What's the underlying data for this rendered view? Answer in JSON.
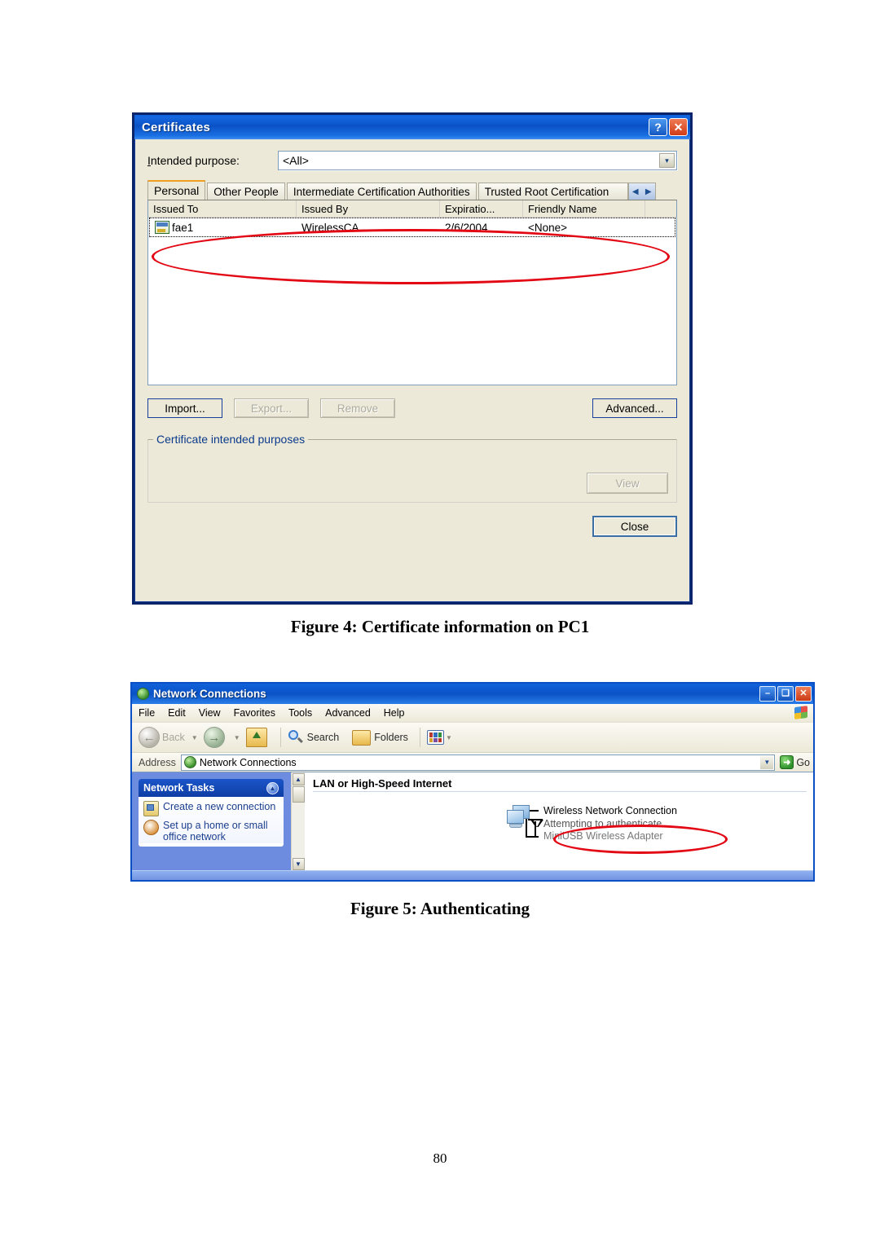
{
  "document": {
    "page_number": "80"
  },
  "figure4": {
    "caption": "Figure 4: Certificate information on PC1",
    "dialog": {
      "title": "Certificates",
      "titlebar_buttons": [
        {
          "name": "help-button",
          "glyph": "?"
        },
        {
          "name": "close-button",
          "glyph": "✕"
        }
      ],
      "intended_purpose": {
        "label": "Intended purpose:",
        "label_accel": "I",
        "value": "<All>",
        "dropdown_glyph": "▾"
      },
      "tabs": [
        {
          "label": "Personal",
          "active": true
        },
        {
          "label": "Other People",
          "active": false
        },
        {
          "label": "Intermediate Certification Authorities",
          "active": false
        },
        {
          "label": "Trusted Root Certification",
          "active": false,
          "clipped": true
        }
      ],
      "tab_scroll": {
        "left_glyph": "◀",
        "right_glyph": "▶"
      },
      "table": {
        "columns": [
          "Issued To",
          "Issued By",
          "Expiratio...",
          "Friendly Name",
          ""
        ],
        "rows": [
          {
            "issued_to": "fae1",
            "issued_by": "WirelessCA",
            "expiration": "2/6/2004",
            "friendly_name": "<None>",
            "selected": true
          }
        ]
      },
      "buttons": {
        "import": {
          "label": "Import...",
          "enabled": true,
          "focused": true
        },
        "export": {
          "label": "Export...",
          "enabled": false
        },
        "remove": {
          "label": "Remove",
          "enabled": false
        },
        "advanced": {
          "label": "Advanced...",
          "enabled": true
        },
        "view": {
          "label": "View",
          "enabled": false
        },
        "close": {
          "label": "Close",
          "enabled": true,
          "default": true
        }
      },
      "group_box": {
        "legend": "Certificate intended purposes",
        "content": ""
      }
    },
    "annotation": {
      "type": "ellipse",
      "color": "#e30613",
      "target": "certificate-row"
    }
  },
  "figure5": {
    "caption": "Figure 5: Authenticating",
    "window": {
      "title": "Network Connections",
      "titlebar_buttons": [
        {
          "name": "minimize-button",
          "glyph": "–"
        },
        {
          "name": "maximize-button",
          "glyph": "❑"
        },
        {
          "name": "close-button",
          "glyph": "✕"
        }
      ],
      "menu": [
        "File",
        "Edit",
        "View",
        "Favorites",
        "Tools",
        "Advanced",
        "Help"
      ],
      "toolbar": {
        "back": {
          "label": "Back",
          "enabled": false
        },
        "forward": {
          "label": "",
          "enabled": true
        },
        "up": {
          "label": "",
          "enabled": true
        },
        "search": {
          "label": "Search"
        },
        "folders": {
          "label": "Folders"
        },
        "views": {
          "label": ""
        }
      },
      "address": {
        "label": "Address",
        "value": "Network Connections",
        "go_label": "Go",
        "go_glyph": "➜"
      },
      "sidebar": {
        "panel_title": "Network Tasks",
        "collapse_glyph": "▲",
        "items": [
          {
            "label": "Create a new connection",
            "icon": "new-connection-icon"
          },
          {
            "label": "Set up a home or small office network",
            "icon": "home-network-icon"
          }
        ]
      },
      "content": {
        "group_header": "LAN or High-Speed Internet",
        "connections": [
          {
            "name": "Wireless Network Connection",
            "status": "Attempting to authenticate",
            "device": "MiniUSB Wireless Adapter"
          }
        ]
      }
    },
    "annotation": {
      "type": "ellipse",
      "color": "#e30613",
      "target": "connection-status"
    }
  }
}
